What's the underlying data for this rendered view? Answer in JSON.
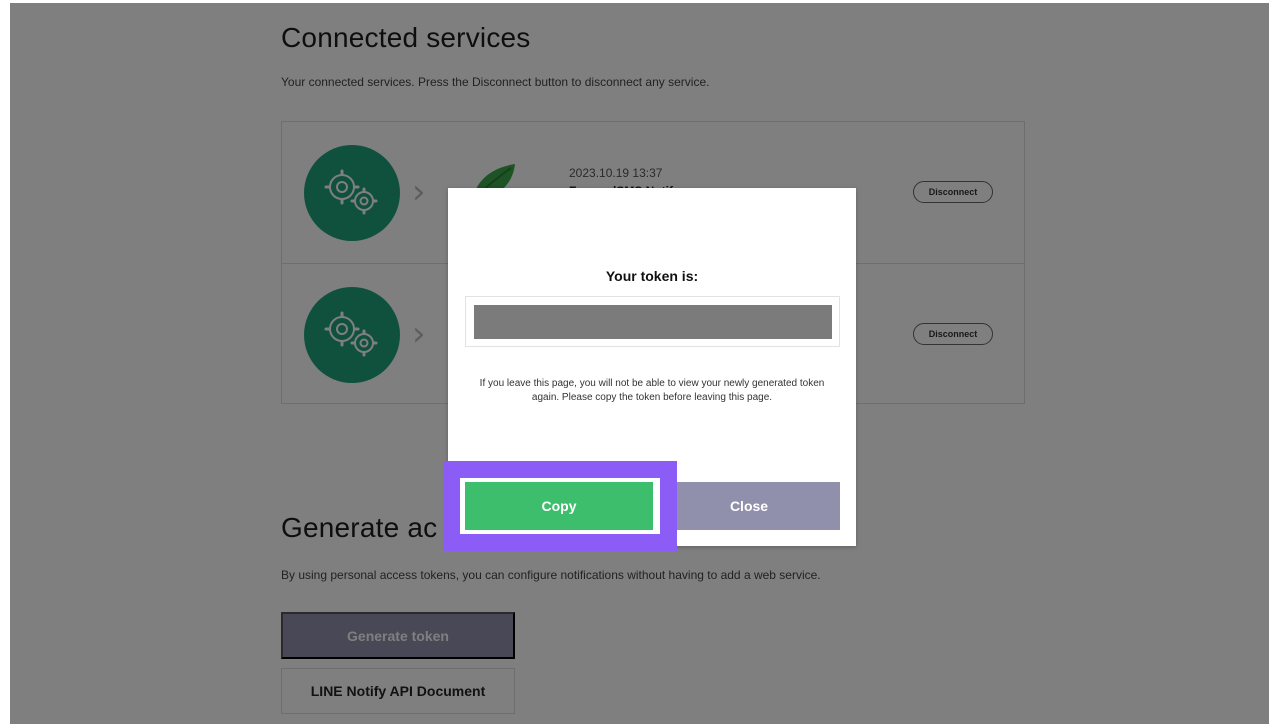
{
  "connected": {
    "title": "Connected services",
    "description": "Your connected services. Press the Disconnect button to disconnect any service.",
    "services": [
      {
        "date": "2023.10.19 13:37",
        "name": "ForwardSMS Notify",
        "disconnect_label": "Disconnect"
      },
      {
        "date": "",
        "name": "",
        "disconnect_label": "Disconnect"
      }
    ]
  },
  "generate": {
    "title": "Generate access token (For developers)",
    "title_visible": "Generate ac",
    "description": "By using personal access tokens, you can configure notifications without having to add a web service.",
    "generate_button": "Generate token",
    "api_doc_button": "LINE Notify API Document"
  },
  "modal": {
    "title": "Your token is:",
    "note": "If you leave this page, you will not be able to view your newly generated token again. Please copy the token before leaving this page.",
    "copy_label": "Copy",
    "close_label": "Close"
  },
  "colors": {
    "copy_green": "#3dbe6c",
    "close_purple": "#9090ac",
    "highlight": "#8b5cf6",
    "service_green": "#1fa27a"
  }
}
